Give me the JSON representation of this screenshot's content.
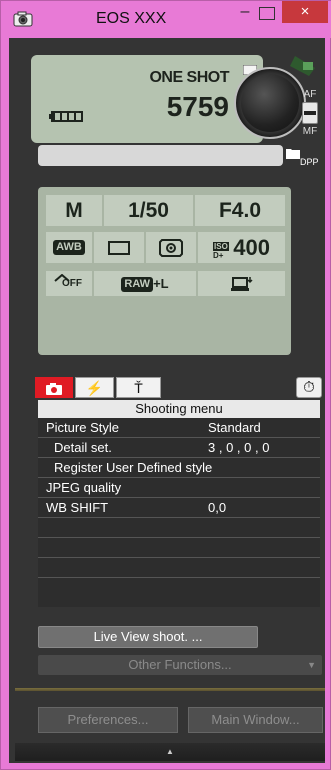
{
  "window": {
    "title": "EOS XXX",
    "minimize": "–",
    "close": "×"
  },
  "lcd_top": {
    "af_mode": "ONE SHOT",
    "shots_remaining": "5759",
    "af": "AF",
    "mf": "MF",
    "dpp": "DPP"
  },
  "lcd_main": {
    "mode": "M",
    "shutter": "1/50",
    "aperture": "F4.0",
    "wb": "AWB",
    "iso_label": "ISO",
    "iso_plus": "D+",
    "iso": "400",
    "alo_off": "OFF",
    "quality_raw": "RAW",
    "quality_suffix": "+L"
  },
  "tabs": [
    {
      "name": "camera",
      "glyph": "",
      "active": true
    },
    {
      "name": "flash",
      "glyph": "⚡"
    },
    {
      "name": "tools",
      "glyph": "Ť"
    }
  ],
  "timer_glyph": "⏱",
  "menu": {
    "title": "Shooting menu",
    "rows": [
      {
        "key": "Picture Style",
        "value": "Standard"
      },
      {
        "key": "Detail set.",
        "value": "3 , 0 , 0 , 0"
      },
      {
        "key": "Register User Defined style",
        "value": ""
      },
      {
        "key": "JPEG quality",
        "value": ""
      },
      {
        "key": "WB SHIFT",
        "value": "0,0"
      }
    ]
  },
  "buttons": {
    "live_view": "Live View shoot. ...",
    "other_functions": "Other Functions...",
    "preferences": "Preferences...",
    "main_window": "Main Window..."
  },
  "colors": {
    "title_bg": "#e87ad6",
    "close_bg": "#c7383d",
    "active_tab": "#e01b24",
    "lcd": "#a9b5a4"
  }
}
